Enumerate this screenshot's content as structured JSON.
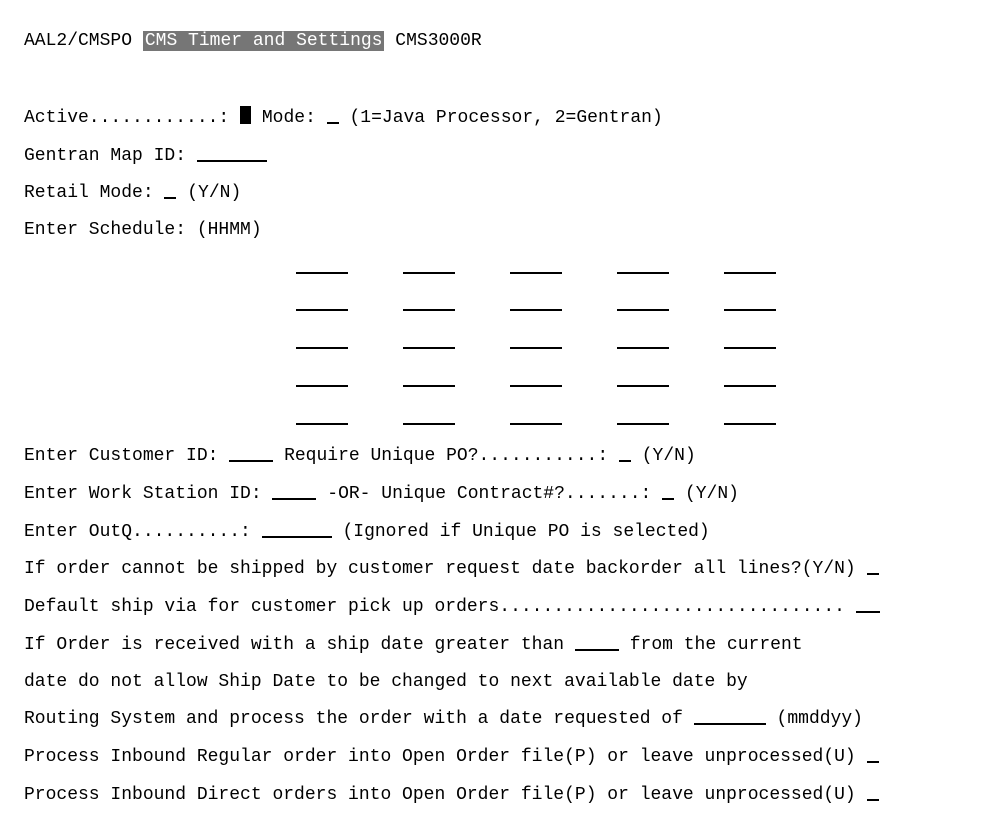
{
  "hdr": {
    "l": "AAL2/CMSPO",
    "c": "CMS Timer and Settings",
    "r": "CMS3000R"
  },
  "lbl": {
    "active": "Active............:",
    "mode": "Mode:",
    "mode_hint": "(1=Java Processor, 2=Gentran)",
    "gmap": "Gentran Map ID:",
    "rmode": "Retail Mode:",
    "yn1": "(Y/N)",
    "sched": "Enter Schedule:  (HHMM)",
    "cust": "Enter Customer ID:",
    "req_upo": "Require Unique PO?...........:",
    "work": "Enter Work Station ID:",
    "or_uc": "-OR- Unique Contract#?.......:",
    "outq": "Enter OutQ..........:",
    "ign": "(Ignored if Unique PO is selected)",
    "bo": "If order cannot be shipped by customer request date backorder all lines?(Y/N)",
    "dsv": "Default ship via for customer pick up orders................................",
    "ifg1": "If Order is received with a ship date greater than",
    "ifg2": "from the current",
    "r2": "date do not allow Ship Date to be changed to next available date by",
    "r3a": "Routing System and process the order with a date requested of",
    "r3b": "(mmddyy)",
    "pir": "Process Inbound Regular order into Open Order file(P) or leave unprocessed(U)",
    "pid": "Process Inbound Direct orders into Open Order file(P) or leave unprocessed(U)"
  }
}
